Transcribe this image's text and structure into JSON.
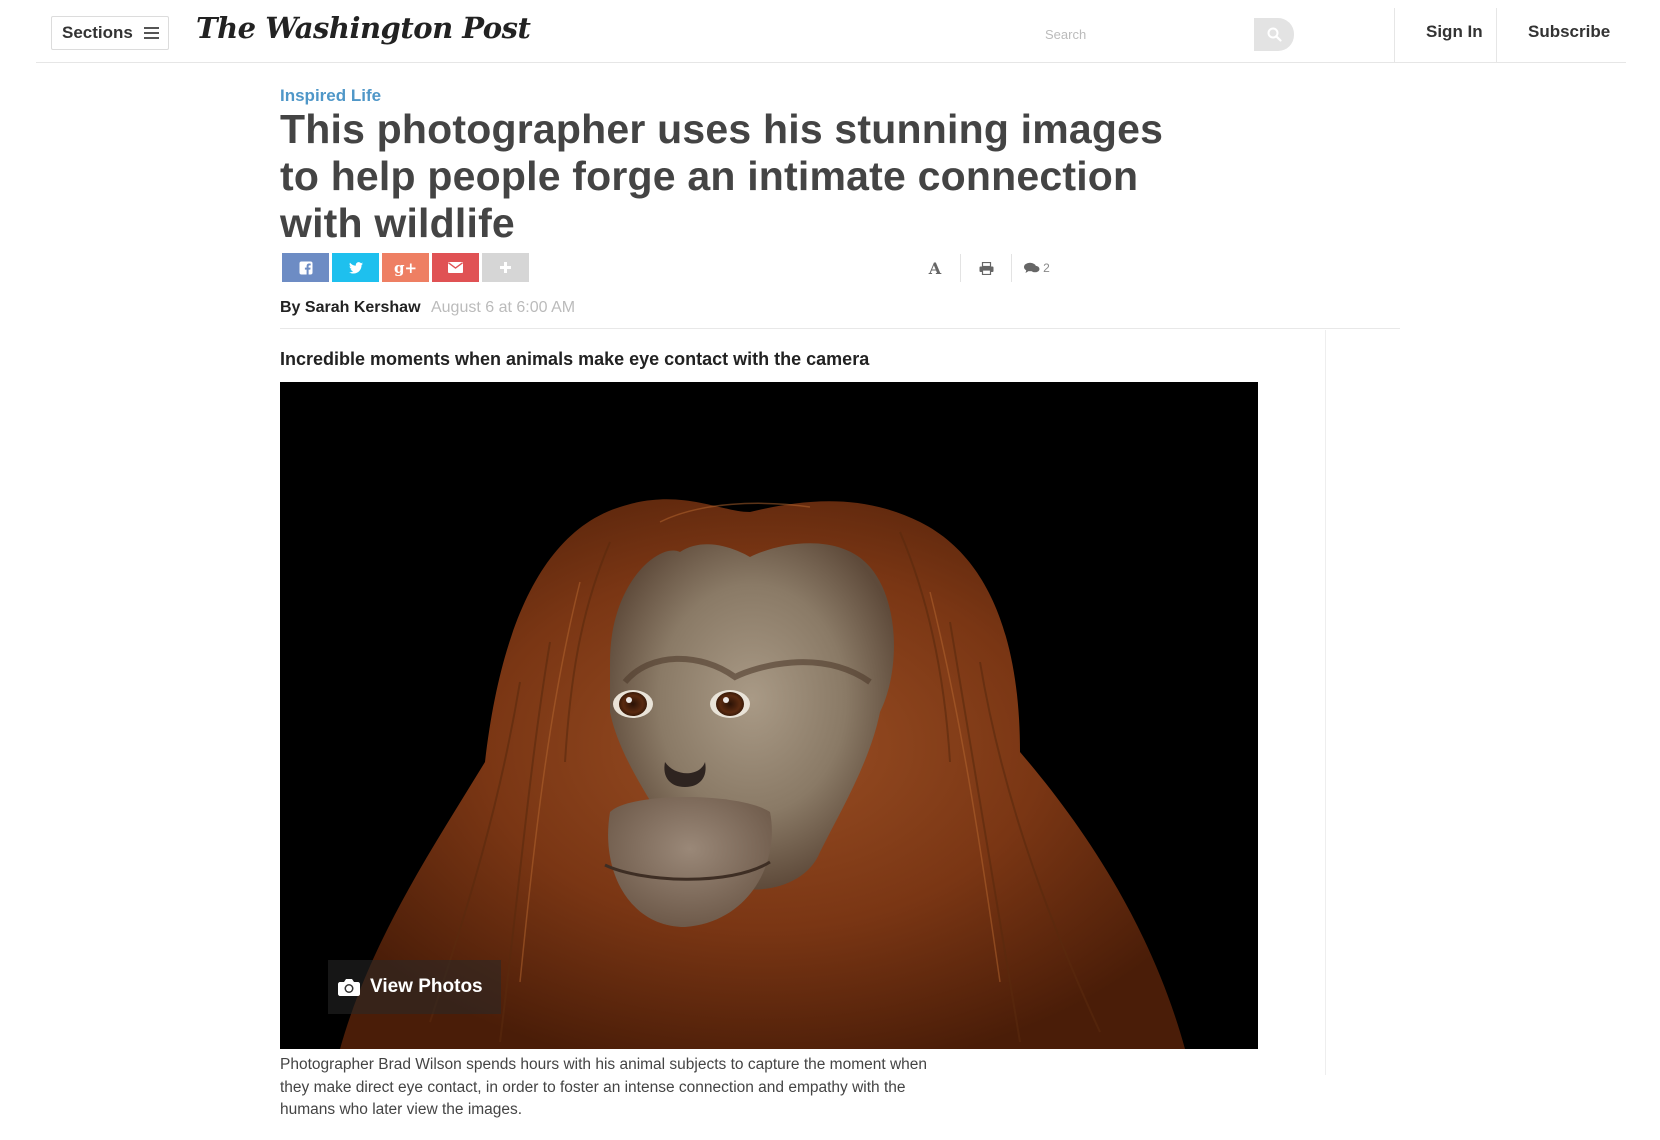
{
  "header": {
    "sections_label": "Sections",
    "logo_text": "The Washington Post",
    "search_placeholder": "Search",
    "signin_label": "Sign In",
    "subscribe_label": "Subscribe"
  },
  "article": {
    "kicker": "Inspired Life",
    "headline": "This photographer uses his stunning images to help people forge an intimate connection with wildlife",
    "share": {
      "facebook_icon": "facebook-icon",
      "twitter_icon": "twitter-icon",
      "googleplus_icon": "google-plus-icon",
      "email_icon": "email-icon",
      "more_icon": "plus-icon",
      "colors": {
        "facebook": "#6d8cc4",
        "twitter": "#1ec0ee",
        "googleplus": "#ee7f63",
        "email": "#e05254",
        "more": "#d6d6d6"
      }
    },
    "tools": {
      "font_icon": "font-size-icon",
      "print_icon": "print-icon",
      "comment_icon": "comment-icon",
      "comment_count": "2"
    },
    "byline_prefix": "By",
    "author": "Sarah Kershaw",
    "date": "August 6 at 6:00 AM",
    "gallery_title": "Incredible moments when animals make eye contact with the camera",
    "photo_subject": "orangutan",
    "view_photos_label": "View Photos",
    "caption": "Photographer Brad Wilson spends hours with his animal subjects to capture the moment when they make direct eye contact, in order to foster an intense connection and empathy with the humans who later view the images."
  },
  "colors": {
    "kicker": "#4f97c8",
    "headline": "#444444",
    "date": "#bbbbbb"
  }
}
